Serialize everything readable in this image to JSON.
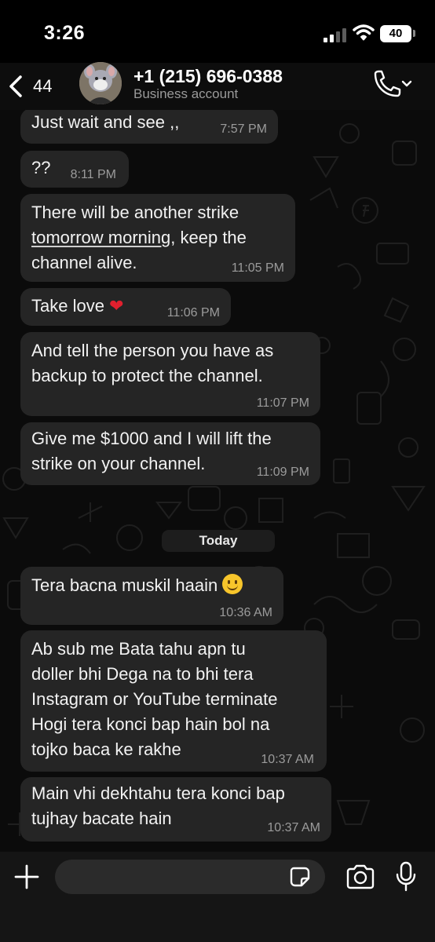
{
  "status_bar": {
    "time": "3:26",
    "battery": "40"
  },
  "header": {
    "back_count": "44",
    "contact_name": "+1 (215) 696-0388",
    "contact_subtitle": "Business account"
  },
  "messages": [
    {
      "text": "Just wait and see ,,",
      "time": "7:57 PM"
    },
    {
      "text": "??",
      "time": "8:11 PM"
    },
    {
      "text_line1_link": "tomorrow morning",
      "text_line1_rest": ", keep the",
      "text_line0": "There will be another strike",
      "text_line2": "channel alive.",
      "time": "11:05 PM"
    },
    {
      "text": "Take love",
      "emoji": "❤️",
      "time": "11:06 PM"
    },
    {
      "text": "And tell the person you have as\nbackup to protect the channel.",
      "time": "11:07 PM"
    },
    {
      "text": "Give me $1000 and I will lift the\nstrike on your channel.",
      "time": "11:09 PM"
    },
    {
      "text": "Tera bacna muskil haain",
      "emoji": "🙂",
      "time": "10:36 AM"
    },
    {
      "text": "Ab sub me Bata tahu apn tu\ndoller bhi Dega na to bhi tera\nInstagram or YouTube terminate\nHogi tera konci bap hain bol na\ntojko baca ke rakhe",
      "time": "10:37 AM"
    },
    {
      "text": "Main vhi dekhtahu tera konci bap\ntujhay bacate hain",
      "time": "10:37 AM"
    }
  ],
  "day_separator": "Today",
  "composer": {
    "placeholder": ""
  },
  "icons": {
    "back": "chevron-left-icon",
    "call": "phone-icon",
    "plus": "plus-icon",
    "sticker": "sticker-icon",
    "camera": "camera-icon",
    "mic": "microphone-icon"
  },
  "colors": {
    "background": "#0b0b0b",
    "bubble": "#252525",
    "timestamp": "#9b9b9b",
    "heart": "#e0202e"
  }
}
